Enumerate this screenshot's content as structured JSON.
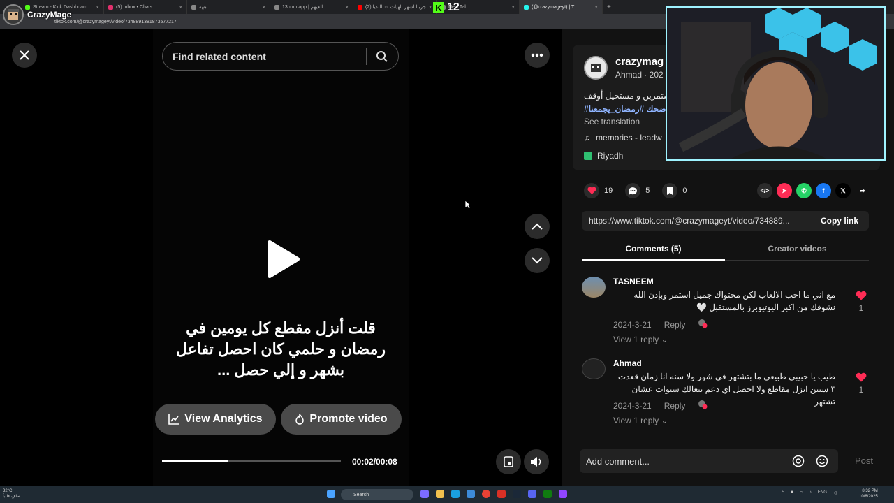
{
  "browser": {
    "tabs": [
      {
        "title": "Stream - Kick Dashboard",
        "color": "#53fc18"
      },
      {
        "title": "(5) Inbox • Chats",
        "color": "#e1306c"
      },
      {
        "title": "ههه",
        "color": "#888888"
      },
      {
        "title": "13bhm.app | العيهم",
        "color": "#888888"
      },
      {
        "title": "(2) جربنا اشهر الهيات ☺ الثديا",
        "color": "#ff0000"
      },
      {
        "title": "New Tab",
        "color": "#888888"
      },
      {
        "title": "(@crazymageyt) | T",
        "color": "#25f4ee",
        "active": true
      }
    ],
    "url": "tiktok.com/@crazymageyt/video/7348891381873577217"
  },
  "overlay": {
    "streamer_name": "CrazyMage",
    "viewer_count": "12",
    "platform_letter": "K"
  },
  "player": {
    "search_placeholder": "Find related content",
    "caption": "قلت أنزل مقطع كل يومين في رمضان و حلمي كان احصل تفاعل بشهر و إلي حصل ...",
    "view_analytics": "View Analytics",
    "promote_video": "Promote video",
    "time": "00:02/00:08",
    "progress": 0.37
  },
  "post": {
    "username": "crazymag",
    "subline": "Ahmad · 202",
    "description": "مستمرين و مستحيل أوقف",
    "hashtags": "#ضحك #رمضان_يجمعنا",
    "see_translation": "See translation",
    "music": "memories - leadw",
    "location": "Riyadh",
    "likes": "19",
    "comments": "5",
    "saves": "0",
    "link": "https://www.tiktok.com/@crazymageyt/video/734889...",
    "copy_link": "Copy link"
  },
  "tabs": {
    "comments": "Comments (5)",
    "creator": "Creator videos"
  },
  "comments": [
    {
      "name": "TASNEEM",
      "text": "مع اني ما احب الالعاب لكن محتواك جميل استمر وبإذن الله نشوفك من اكبر اليوتيوبرز بالمستقبل 🤍",
      "date": "2024-3-21",
      "reply": "Reply",
      "view_replies": "View 1 reply",
      "likes": "1"
    },
    {
      "name": "Ahmad",
      "text": "طيب يا حبيبي طبيعي ما بتشتهر في شهر ولا سنه انا زمان قعدت ٣ سنين انزل مقاطع ولا احصل اي دعم بيغالك سنوات عشان تشتهر",
      "date": "2024-3-21",
      "reply": "Reply",
      "view_replies": "View 1 reply",
      "likes": "1"
    }
  ],
  "add_comment": {
    "placeholder": "Add comment...",
    "post": "Post"
  },
  "taskbar": {
    "weather_temp": "32°C",
    "weather_desc": "صافٍ غالباً",
    "search": "Search",
    "tray_lang": "ENG",
    "time": "8:32 PM",
    "date": "10/8/2025"
  }
}
